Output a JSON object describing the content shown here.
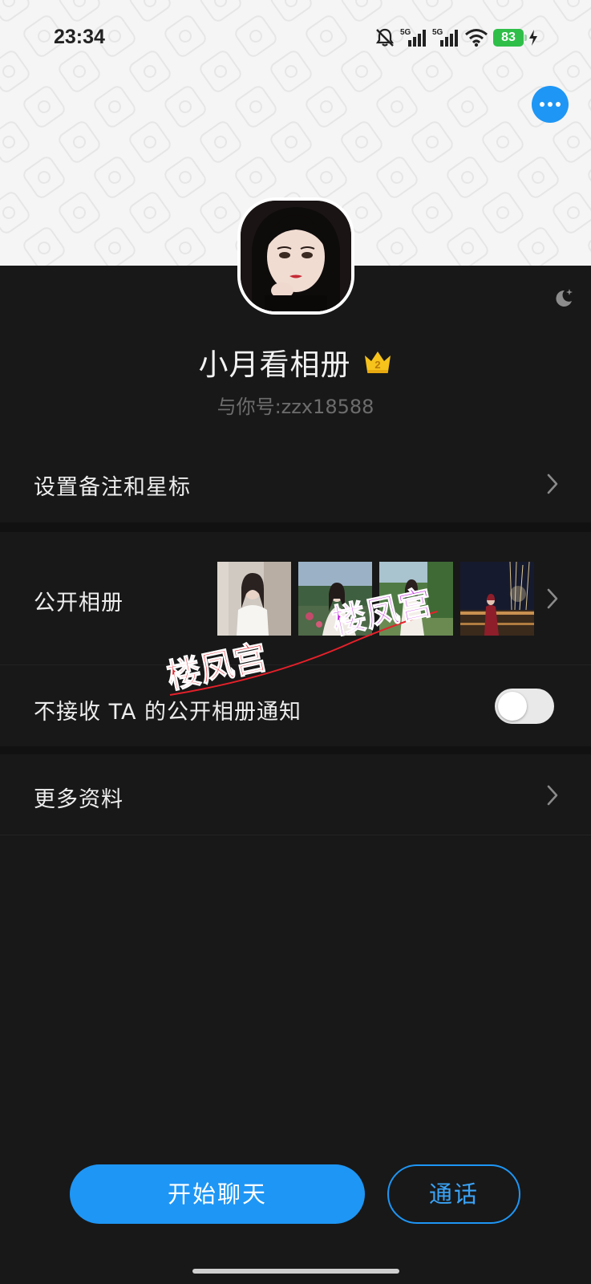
{
  "status_bar": {
    "time": "23:34",
    "battery": "83",
    "icons": [
      "bell-muted-icon",
      "signal-5g-icon",
      "signal-5g-icon",
      "wifi-icon",
      "battery-icon",
      "charging-icon"
    ],
    "network_label": "5G"
  },
  "header": {
    "more_icon": "more-dots-icon",
    "night_mode_icon": "moon-star-icon"
  },
  "profile": {
    "name": "小月看相册",
    "badge_level": "2",
    "account_id": "与你号:zzx18588"
  },
  "menu": {
    "remark_label": "设置备注和星标",
    "album_label": "公开相册",
    "notify_label": "不接收 TA 的公开相册通知",
    "notify_enabled": false,
    "more_label": "更多资料"
  },
  "watermarks": [
    "楼凤宫",
    "楼凤宫"
  ],
  "actions": {
    "chat_label": "开始聊天",
    "call_label": "通话"
  },
  "colors": {
    "accent": "#1e96f5",
    "background": "#181818",
    "battery": "#2fbf49",
    "watermark_red": "#e6202a",
    "watermark_purple": "#c21ee0"
  }
}
